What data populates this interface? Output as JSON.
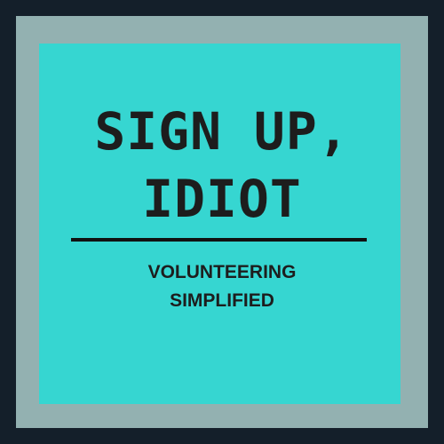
{
  "colors": {
    "outer_border": "#141f2a",
    "frame": "#93b1b1",
    "panel": "#36d6d1",
    "text": "#1d1d1d",
    "divider": "#111111"
  },
  "title": {
    "line1": "SIGN UP,",
    "line2": "IDIOT"
  },
  "tagline": {
    "line1": "VOLUNTEERING",
    "line2": "SIMPLIFIED"
  }
}
